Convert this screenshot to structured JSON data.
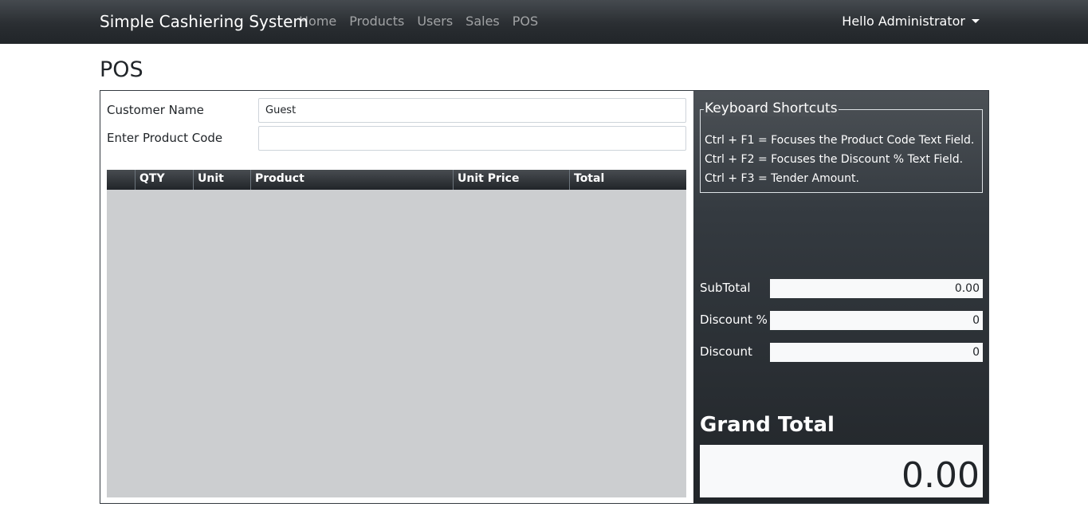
{
  "navbar": {
    "brand": "Simple Cashiering System",
    "links": [
      "Home",
      "Products",
      "Users",
      "Sales",
      "POS"
    ],
    "user_label": "Hello Administrator"
  },
  "page": {
    "title": "POS"
  },
  "form": {
    "customer_label": "Customer Name",
    "customer_value": "Guest",
    "product_code_label": "Enter Product Code",
    "product_code_value": ""
  },
  "table": {
    "columns": [
      "",
      "QTY",
      "Unit",
      "Product",
      "Unit Price",
      "Total"
    ],
    "rows": []
  },
  "shortcuts": {
    "title": "Keyboard Shortcuts",
    "items": [
      "Ctrl + F1 = Focuses the Product Code Text Field.",
      "Ctrl + F2 = Focuses the Discount % Text Field.",
      "Ctrl + F3 = Tender Amount."
    ]
  },
  "totals": {
    "subtotal_label": "SubTotal",
    "subtotal_value": "0.00",
    "discount_percent_label": "Discount %",
    "discount_percent_value": "0",
    "discount_label": "Discount",
    "discount_value": "0",
    "grand_total_label": "Grand Total",
    "grand_total_value": "0.00"
  }
}
